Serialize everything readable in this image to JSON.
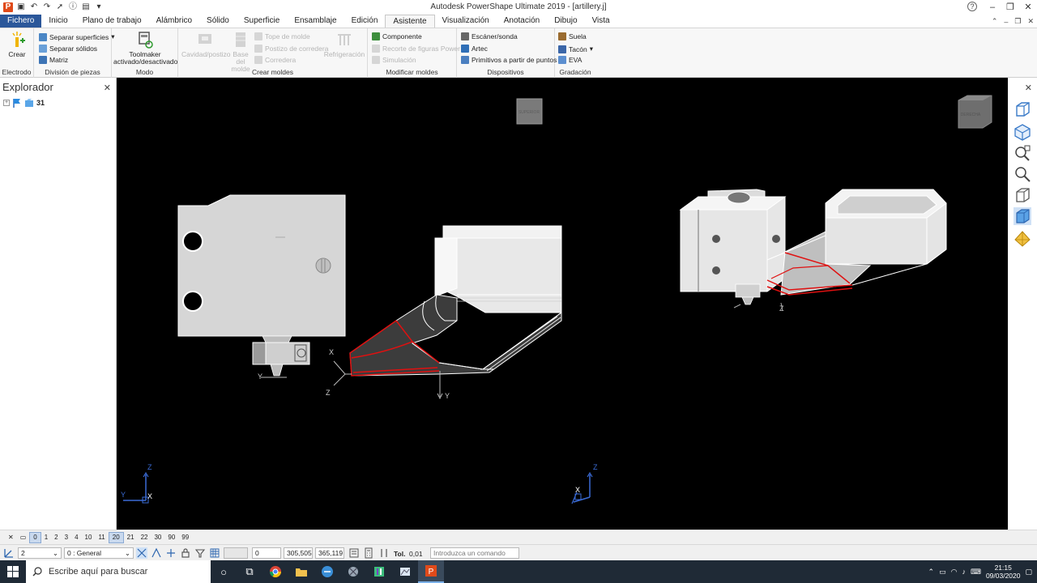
{
  "window": {
    "title": "Autodesk PowerShape Ultimate 2019 - [artillery.j]"
  },
  "tabs": [
    {
      "label": "Fichero"
    },
    {
      "label": "Inicio"
    },
    {
      "label": "Plano de trabajo"
    },
    {
      "label": "Alámbrico"
    },
    {
      "label": "Sólido"
    },
    {
      "label": "Superficie"
    },
    {
      "label": "Ensamblaje"
    },
    {
      "label": "Edición"
    },
    {
      "label": "Asistente"
    },
    {
      "label": "Visualización"
    },
    {
      "label": "Anotación"
    },
    {
      "label": "Dibujo"
    },
    {
      "label": "Vista"
    }
  ],
  "ribbon": {
    "electrodo": {
      "label": "Electrodo",
      "crear": "Crear"
    },
    "division": {
      "label": "División de piezas",
      "separar_superficies": "Separar superficies",
      "separar_solidos": "Separar sólidos",
      "matriz": "Matriz"
    },
    "modo": {
      "label": "Modo",
      "toolmaker_1": "Toolmaker",
      "toolmaker_2": "activado/desactivado"
    },
    "crear_moldes": {
      "label": "Crear moldes",
      "cavidad": "Cavidad/postizo",
      "base_1": "Base del",
      "base_2": "molde",
      "tope": "Tope de molde",
      "postizo_corredera": "Postizo de corredera",
      "corredera": "Corredera",
      "refrigeracion": "Refrigeración"
    },
    "modificar": {
      "label": "Modificar moldes",
      "componente": "Componente",
      "recorte": "Recorte de figuras Power",
      "simulacion": "Simulación"
    },
    "dispositivos": {
      "label": "Dispositivos",
      "escaner": "Escáner/sonda",
      "artec": "Artec",
      "primitivos": "Primitivos a partir de puntos"
    },
    "gradacion": {
      "label": "Gradación",
      "suela": "Suela",
      "tacon": "Tacón",
      "eva": "EVA"
    }
  },
  "explorer": {
    "title": "Explorador",
    "tree_item": "31"
  },
  "viewport": {
    "axes_left": {
      "x": "X",
      "y": "Y",
      "z": "Z"
    },
    "axes_mid": {
      "x": "X",
      "y": "Y",
      "z": "Z"
    },
    "triad_bl": {
      "z": "Z",
      "y": "Y",
      "x": "X"
    },
    "triad_br": {
      "z": "Z",
      "x": "X"
    },
    "cube_left_label": "SUPERIOR",
    "cube_right_label": "DERECHA"
  },
  "levels": [
    "0",
    "1",
    "2",
    "3",
    "4",
    "10",
    "11",
    "20",
    "21",
    "22",
    "30",
    "90",
    "99"
  ],
  "statusbar": {
    "workplane_value": "2",
    "level_select": "0  : General",
    "coord_x": "0",
    "coord_y": "305,505",
    "coord_z": "365,119",
    "tol_label": "Tol.",
    "tol_value": "0,01",
    "command_placeholder": "Introduzca un comando"
  },
  "taskbar": {
    "search_placeholder": "Escribe aquí para buscar",
    "time": "21:15",
    "date": "09/03/2020"
  },
  "colors": {
    "file_tab": "#2b579a",
    "viewport_bg": "#000000",
    "highlight_edge": "#e01010",
    "taskbar": "#1f2a36"
  }
}
